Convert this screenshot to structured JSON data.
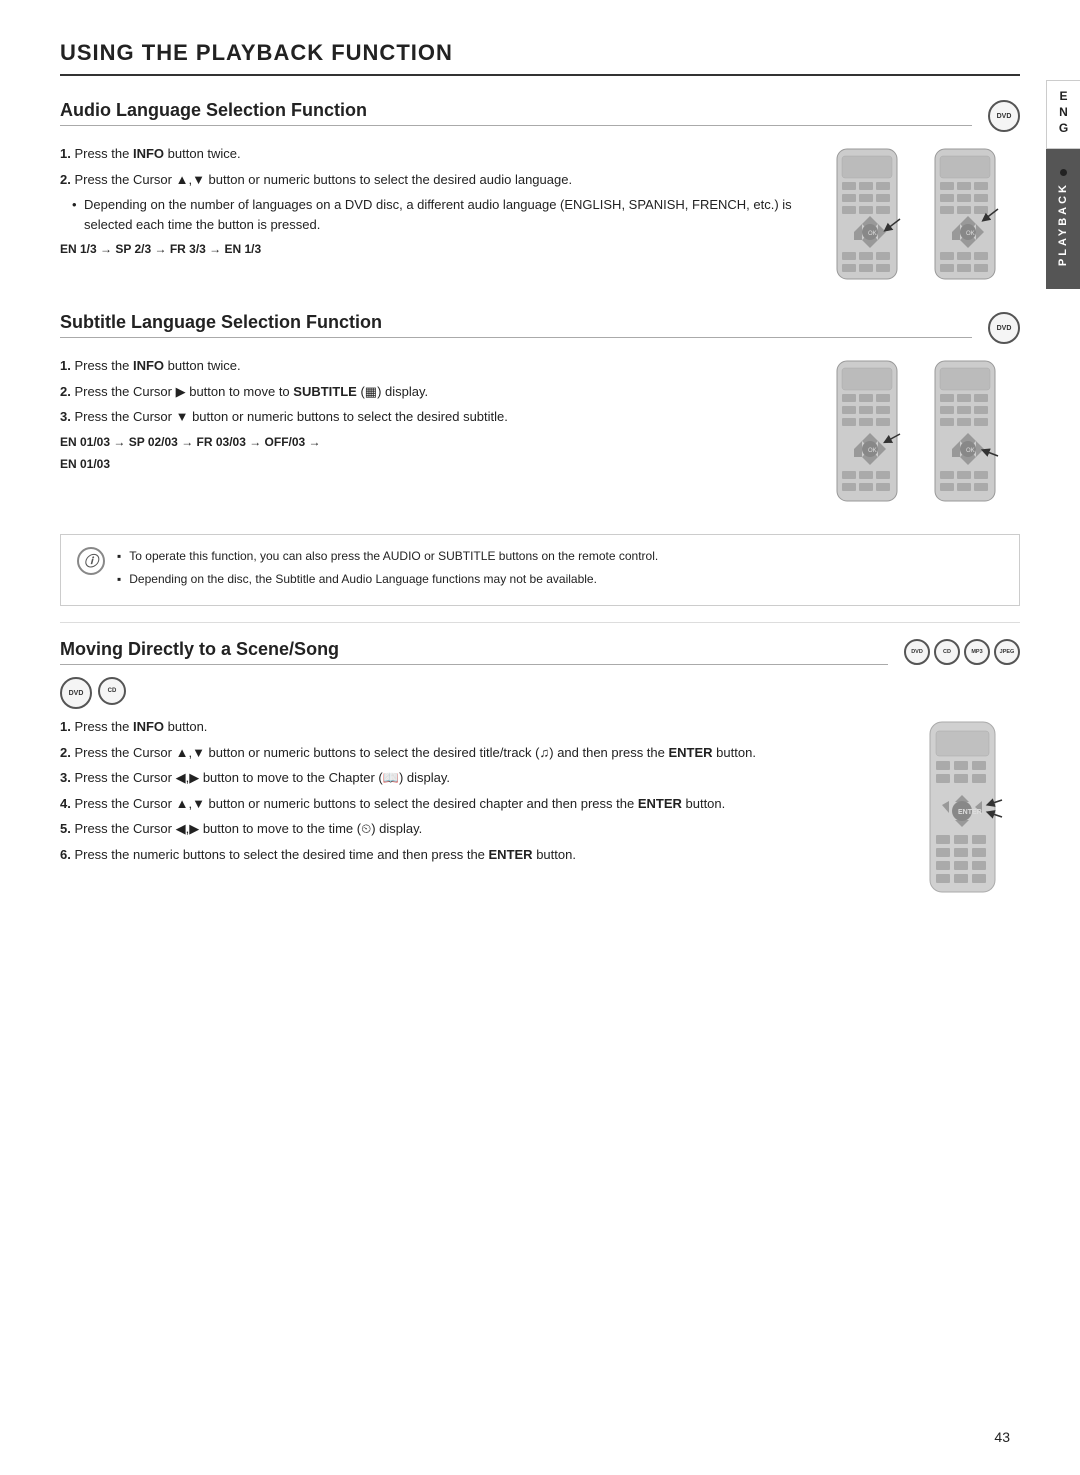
{
  "page": {
    "title": "USING THE PLAYBACK FUNCTION",
    "page_number": "43",
    "tab_eng": "ENG",
    "tab_playback": "PLAYBACK"
  },
  "sections": {
    "audio": {
      "title": "Audio Language Selection Function",
      "badge": "DVD",
      "steps": [
        {
          "num": "1.",
          "text": "Press the ",
          "bold": "INFO",
          "text2": " button twice."
        },
        {
          "num": "2.",
          "text": "Press the Cursor ▲,▼ button or numeric buttons to select the desired audio language."
        }
      ],
      "bullet": "Depending on the number of languages on a DVD disc, a different audio language (ENGLISH, SPANISH, FRENCH, etc.) is selected each time the button is pressed.",
      "formula": "EN 1/3 → SP 2/3 → FR 3/3 → EN 1/3"
    },
    "subtitle": {
      "title": "Subtitle Language Selection Function",
      "badge": "DVD",
      "steps": [
        {
          "num": "1.",
          "text": "Press the ",
          "bold": "INFO",
          "text2": " button twice."
        },
        {
          "num": "2.",
          "text": "Press the Cursor ▶ button to move to ",
          "bold": "SUBTITLE",
          "text2": " (🔲) display."
        },
        {
          "num": "3.",
          "text": "Press the Cursor ▼ button or numeric buttons to select the desired subtitle."
        }
      ],
      "formula1": "EN 01/03 → SP 02/03 → FR 03/03 → OFF/03 →",
      "formula2": "EN 01/03"
    },
    "note": {
      "items": [
        "To operate this function, you can also press the AUDIO or SUBTITLE buttons on the remote control.",
        "Depending on the disc, the Subtitle and Audio Language functions may not be available."
      ]
    },
    "moving": {
      "title": "Moving Directly to a Scene/Song",
      "badges": [
        "DVD",
        "CD",
        "MP3",
        "JPEG"
      ],
      "sub_badges": [
        "DVD",
        "CD"
      ],
      "steps": [
        {
          "num": "1.",
          "text": "Press the ",
          "bold": "INFO",
          "text2": " button."
        },
        {
          "num": "2.",
          "text": "Press the Cursor ▲,▼ button or numeric buttons to select the desired title/track (🎵) and then press the ",
          "bold": "ENTER",
          "text2": " button."
        },
        {
          "num": "3.",
          "text": "Press the Cursor ◀,▶ button to move to the Chapter (📖) display."
        },
        {
          "num": "4.",
          "text": "Press the Cursor ▲,▼ button or numeric buttons to select the desired chapter and then press the ",
          "bold": "ENTER",
          "text2": " button."
        },
        {
          "num": "5.",
          "text": "Press the Cursor ◀,▶ button to move to the time (⏱) display."
        },
        {
          "num": "6.",
          "text": "Press the numeric buttons to select the desired time and then press the ",
          "bold": "ENTER",
          "text2": " button."
        }
      ]
    }
  }
}
